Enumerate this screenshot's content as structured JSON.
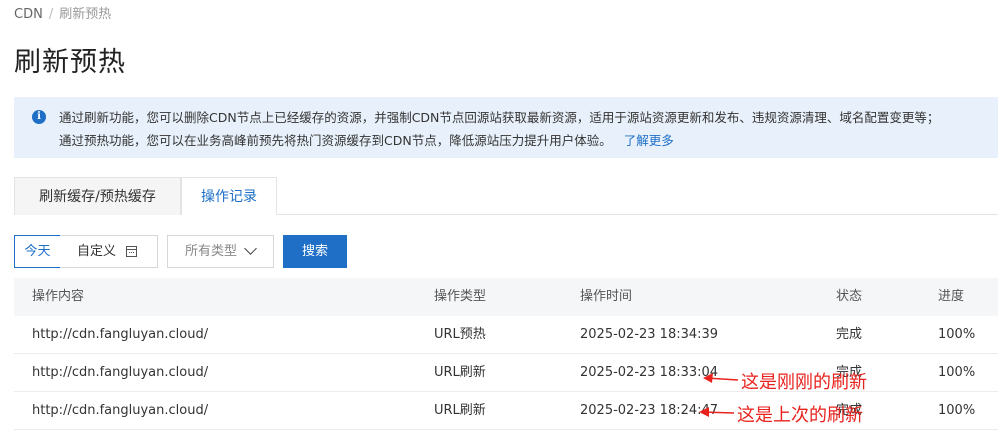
{
  "breadcrumb": {
    "root": "CDN",
    "separator": "/",
    "current": "刷新预热"
  },
  "page": {
    "title": "刷新预热"
  },
  "notice": {
    "icon": "info-icon",
    "line1": "通过刷新功能，您可以删除CDN节点上已经缓存的资源，并强制CDN节点回源站获取最新资源，适用于源站资源更新和发布、违规资源清理、域名配置变更等；",
    "line2": "通过预热功能，您可以在业务高峰前预先将热门资源缓存到CDN节点，降低源站压力提升用户体验。",
    "link": "了解更多",
    "color": "#1f6fc7"
  },
  "tabs": [
    {
      "label": "刷新缓存/预热缓存",
      "active": false
    },
    {
      "label": "操作记录",
      "active": true
    }
  ],
  "filters": {
    "today": "今天",
    "custom": "自定义",
    "type_select": "所有类型",
    "search": "搜索"
  },
  "table": {
    "headers": [
      "操作内容",
      "操作类型",
      "操作时间",
      "状态",
      "进度"
    ],
    "rows": [
      {
        "content": "http://cdn.fangluyan.cloud/",
        "type": "URL预热",
        "time": "2025-02-23 18:34:39",
        "status": "完成",
        "progress": "100%"
      },
      {
        "content": "http://cdn.fangluyan.cloud/",
        "type": "URL刷新",
        "time": "2025-02-23 18:33:04",
        "status": "完成",
        "progress": "100%"
      },
      {
        "content": "http://cdn.fangluyan.cloud/",
        "type": "URL刷新",
        "time": "2025-02-23 18:24:47",
        "status": "完成",
        "progress": "100%"
      }
    ]
  },
  "annotations": {
    "latest": "这是刚刚的刷新",
    "previous": "这是上次的刷新",
    "color": "#e8231e"
  }
}
